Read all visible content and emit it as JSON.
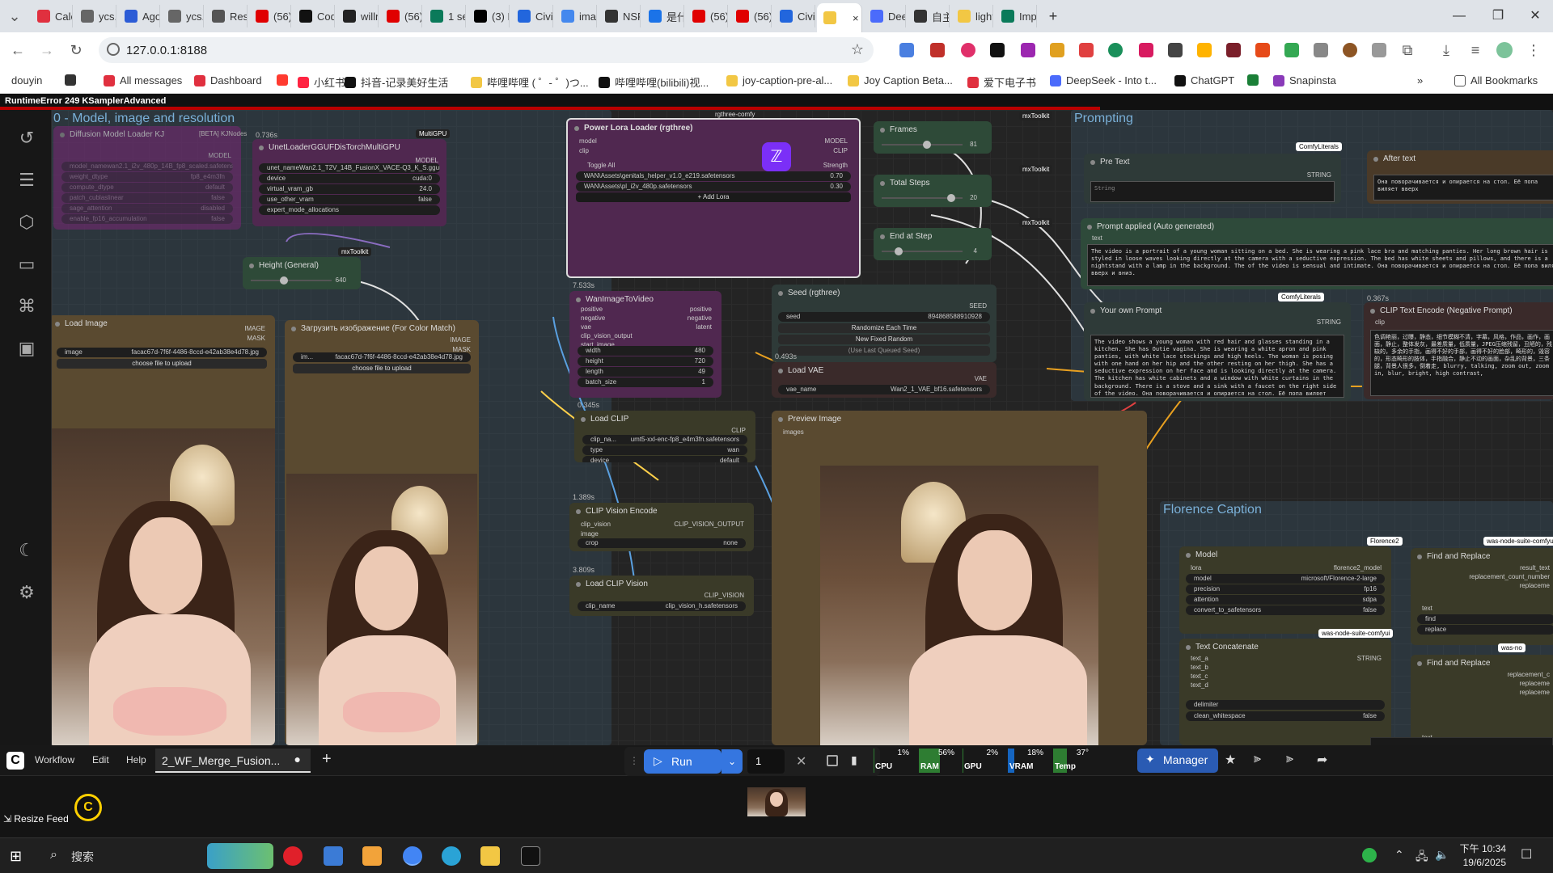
{
  "browser": {
    "tabs": [
      {
        "label": "Cale",
        "color": "#e0303f"
      },
      {
        "label": "ycs.a",
        "color": "#666666"
      },
      {
        "label": "Ago",
        "color": "#2c5cd6"
      },
      {
        "label": "ycs.a",
        "color": "#666666"
      },
      {
        "label": "Rese",
        "color": "#555555"
      },
      {
        "label": "(56)",
        "color": "#e00000"
      },
      {
        "label": "Cod",
        "color": "#111111"
      },
      {
        "label": "willn",
        "color": "#222222"
      },
      {
        "label": "(56)",
        "color": "#e00000"
      },
      {
        "label": "1 se",
        "color": "#0a7a5a"
      },
      {
        "label": "(3) F",
        "color": "#000000"
      },
      {
        "label": "Civit",
        "color": "#2266dd"
      },
      {
        "label": "imag",
        "color": "#4488ee"
      },
      {
        "label": "NSF",
        "color": "#333333"
      },
      {
        "label": "是什",
        "color": "#1b73e8"
      },
      {
        "label": "(56)",
        "color": "#e00000"
      },
      {
        "label": "(56)",
        "color": "#e00000"
      },
      {
        "label": "Civit",
        "color": "#2266dd"
      },
      {
        "label": "",
        "color": "#f2c744",
        "active": true
      },
      {
        "label": "Dee",
        "color": "#4b6bfb"
      },
      {
        "label": "自主",
        "color": "#333333"
      },
      {
        "label": "light",
        "color": "#f2c744"
      },
      {
        "label": "Imp",
        "color": "#0a7a5a"
      }
    ],
    "close_tab": "×",
    "new_tab": "+",
    "window_min": "—",
    "window_max": "❐",
    "window_close": "✕",
    "url": "127.0.0.1:8188",
    "bookmarks": [
      {
        "label": "douyin",
        "color": "#ffffff"
      },
      {
        "label": "",
        "color": "#333333"
      },
      {
        "label": "All messages",
        "color": "#e0303f"
      },
      {
        "label": "Dashboard",
        "color": "#e0303f"
      },
      {
        "label": "",
        "color": "#ff3b30"
      },
      {
        "label": "小红书",
        "color": "#ff2442"
      },
      {
        "label": "抖音-记录美好生活",
        "color": "#111111"
      },
      {
        "label": "哔哩哔哩 ( ゜- ゜)つ...",
        "color": "#f2c744"
      },
      {
        "label": "哔哩哔哩(bilibili)视...",
        "color": "#111111"
      },
      {
        "label": "joy-caption-pre-al...",
        "color": "#f2c744"
      },
      {
        "label": "Joy Caption Beta...",
        "color": "#f2c744"
      },
      {
        "label": "爱下电子书",
        "color": "#e0303f"
      },
      {
        "label": "DeepSeek - Into t...",
        "color": "#4b6bfb"
      },
      {
        "label": "ChatGPT",
        "color": "#111111"
      },
      {
        "label": "",
        "color": "#1a7f37"
      },
      {
        "label": "Snapinsta",
        "color": "#8a3ab9"
      }
    ],
    "bookmarks_more": "»",
    "all_bookmarks": "All Bookmarks"
  },
  "app": {
    "error_text": "RuntimeError 249 KSamplerAdvanced",
    "groups": {
      "model": "0 - Model, image and resolution",
      "prompting": "Prompting",
      "florence": "Florence Caption"
    },
    "nodes": {
      "diffusion": {
        "title": "Diffusion Model Loader KJ",
        "badge": "[BETA] KJNodes",
        "out": "MODEL",
        "widgets": [
          [
            "model_name",
            "wan2.1_i2v_480p_14B_fp8_scaled.safetensors"
          ],
          [
            "weight_dtype",
            "fp8_e4m3fn"
          ],
          [
            "compute_dtype",
            "default"
          ],
          [
            "patch_cublaslinear",
            "false"
          ],
          [
            "sage_attention",
            "disabled"
          ],
          [
            "enable_fp16_accumulation",
            "false"
          ]
        ]
      },
      "unet": {
        "time": "0.736s",
        "badge": "MultiGPU",
        "title": "UnetLoaderGGUFDisTorchMultiGPU",
        "out": "MODEL",
        "widgets": [
          [
            "unet_name",
            "Wan2.1_T2V_14B_FusionX_VACE-Q3_K_S.gguf"
          ],
          [
            "device",
            "cuda:0"
          ],
          [
            "virtual_vram_gb",
            "24.0"
          ],
          [
            "use_other_vram",
            "false"
          ],
          [
            "expert_mode_allocations",
            ""
          ]
        ]
      },
      "lora": {
        "badge": "rgthree-comfy",
        "title": "Power Lora Loader (rgthree)",
        "in_model": "model",
        "in_clip": "clip",
        "out_model": "MODEL",
        "out_clip": "CLIP",
        "toggle_all": "Toggle All",
        "strength": "Strength",
        "loras": [
          [
            "WAN\\Assets\\genitals_helper_v1.0_e219.safetensors",
            "0.70"
          ],
          [
            "WAN\\Assets\\pl_i2v_480p.safetensors",
            "0.30"
          ]
        ],
        "add": "+ Add Lora"
      },
      "frames": {
        "title": "Frames",
        "badge": "mxToolkit",
        "value": "81",
        "fraction": 0.55
      },
      "total_steps": {
        "title": "Total Steps",
        "badge": "mxToolkit",
        "value": "20",
        "fraction": 0.85
      },
      "end_step": {
        "title": "End at Step",
        "badge": "mxToolkit",
        "value": "4",
        "fraction": 0.2
      },
      "height": {
        "title": "Height (General)",
        "badge": "mxToolkit",
        "value": "640",
        "fraction": 0.4
      },
      "load_image": {
        "title": "Load Image",
        "out_image": "IMAGE",
        "out_mask": "MASK",
        "image": "facac67d-7f6f-4486-8ccd-e42ab38e4d78.jpg",
        "upload": "choose file to upload"
      },
      "load_image2": {
        "title": "Загрузить изображение (For Color Match)",
        "out_image": "IMAGE",
        "out_mask": "MASK",
        "image": "facac67d-7f6f-4486-8ccd-e42ab38e4d78.jpg",
        "upload": "choose file to upload"
      },
      "wan": {
        "time": "7.533s",
        "title": "WanImageToVideo",
        "inputs": [
          "positive",
          "negative",
          "vae",
          "clip_vision_output",
          "start_image"
        ],
        "outputs": [
          "positive",
          "negative",
          "latent"
        ],
        "widgets": [
          [
            "width",
            "480"
          ],
          [
            "height",
            "720"
          ],
          [
            "length",
            "49"
          ],
          [
            "batch_size",
            "1"
          ]
        ]
      },
      "seed": {
        "badge": "rgthree-comfy",
        "title": "Seed (rgthree)",
        "out": "SEED",
        "seed_label": "seed",
        "seed_value": "894868588910928",
        "btn1": "Randomize Each Time",
        "btn2": "New Fixed Random",
        "btn3": "(Use Last Queued Seed)"
      },
      "vae": {
        "time": "0.493s",
        "title": "Load VAE",
        "out": "VAE",
        "label": "vae_name",
        "value": "Wan2_1_VAE_bf16.safetensors"
      },
      "clip": {
        "time": "0.345s",
        "title": "Load CLIP",
        "out": "CLIP",
        "widgets": [
          [
            "clip_na...",
            "umt5-xxl-enc-fp8_e4m3fn.safetensors"
          ],
          [
            "type",
            "wan"
          ],
          [
            "device",
            "default"
          ]
        ]
      },
      "clip_vision_encode": {
        "time": "1.389s",
        "title": "CLIP Vision Encode",
        "in1": "clip_vision",
        "in2": "image",
        "out": "CLIP_VISION_OUTPUT",
        "crop_label": "crop",
        "crop_value": "none"
      },
      "clip_vision": {
        "time": "3.809s",
        "title": "Load CLIP Vision",
        "out": "CLIP_VISION",
        "label": "clip_name",
        "value": "clip_vision_h.safetensors"
      },
      "preview": {
        "title": "Preview Image",
        "in": "images"
      },
      "pre_text": {
        "title": "Pre Text",
        "badge": "ComfyLiterals",
        "out": "STRING",
        "placeholder": "String"
      },
      "after_text": {
        "title": "After text",
        "text": "Она поворачивается и опирается на стол. Её попа виляет вверх"
      },
      "prompt_applied": {
        "title": "Prompt applied (Auto generated)",
        "in": "text",
        "text": "The video is a portrait of a young woman sitting on a bed. She is wearing a pink lace bra and matching panties. Her long brown hair is styled in loose waves looking directly at the camera with a seductive expression. The bed has white sheets and pillows, and there is a nightstand with a lamp in the background. The of the video is sensual and intimate. Она поворачивается и опирается на стол. Её попа виляет вверх и вниз."
      },
      "own_prompt": {
        "badge": "ComfyLiterals",
        "title": "Your own Prompt",
        "out": "STRING",
        "text": "The video shows a young woman with red hair and glasses standing in a kitchen. She has Outie vagina. She is wearing a white apron and pink panties, with white lace stockings and high heels. The woman is posing with one hand on her hip and the other resting on her thigh. She has a seductive expression on her face and is looking directly at the camera. The kitchen has white cabinets and a window with white curtains in the background. There is a stove and a sink with a faucet on the right side of the video. Она поворачивается и опирается на стол. Её попа виляет вверх и вниз."
      },
      "neg": {
        "time": "0.367s",
        "title": "CLIP Text Encode (Negative Prompt)",
        "in": "clip",
        "text": "色调艳丽，过曝，静态，细节模糊不清，字幕，风格，作品，画作，画面，静止，整体发灰，最差质量，低质量，JPEG压缩残留，丑陋的，残缺的，多余的手指，画得不好的手部，画得不好的脸部，畸形的，毁容的，形态畸形的肢体，手指融合，静止不动的画面，杂乱的背景，三条腿，背景人很多，倒着走, blurry, talking, zoom out, zoom in, blur, bright, high contrast,"
      },
      "model": {
        "badge": "Florence2",
        "title": "Model",
        "in": "lora",
        "out": "florence2_model",
        "widgets": [
          [
            "model",
            "microsoft/Florence-2-large"
          ],
          [
            "precision",
            "fp16"
          ],
          [
            "attention",
            "sdpa"
          ],
          [
            "convert_to_safetensors",
            "false"
          ]
        ]
      },
      "text_concat": {
        "badge": "was-node-suite-comfyui",
        "title": "Text Concatenate",
        "out": "STRING",
        "inputs": [
          "text_a",
          "text_b",
          "text_c",
          "text_d"
        ],
        "widgets": [
          [
            "delimiter",
            ""
          ],
          [
            "clean_whitespace",
            "false"
          ]
        ]
      },
      "find1": {
        "badge": "was-node-suite-comfyui",
        "title": "Find and Replace",
        "outs": [
          "result_text",
          "replacement_count_number",
          "replaceme"
        ],
        "in": "text",
        "widgets": [
          [
            "find",
            ""
          ],
          [
            "replace",
            ""
          ]
        ]
      },
      "find2": {
        "badge": "was-no",
        "title": "Find and Replace",
        "outs": [
          "replacement_c",
          "replaceme",
          "replaceme"
        ],
        "in": "text"
      }
    },
    "bottom": {
      "menu": [
        "Workflow",
        "Edit",
        "Help"
      ],
      "workflow_tab": "2_WF_Merge_Fusion...",
      "add_tab": "+",
      "run": "Run",
      "queue_count": "1",
      "stats": [
        {
          "label": "CPU",
          "value": "1%",
          "fill": 0.01,
          "color": "#2e7d32"
        },
        {
          "label": "RAM",
          "value": "56%",
          "fill": 0.56,
          "color": "#2e7d32"
        },
        {
          "label": "GPU",
          "value": "2%",
          "fill": 0.02,
          "color": "#2e7d32"
        },
        {
          "label": "VRAM",
          "value": "18%",
          "fill": 0.18,
          "color": "#1565c0"
        },
        {
          "label": "Temp",
          "value": "37°",
          "fill": 0.37,
          "color": "#2e7d32"
        }
      ],
      "manager": "Manager",
      "resize_feed": "Resize Feed"
    }
  },
  "taskbar": {
    "search": "搜索",
    "time": "下午 10:34",
    "date": "19/6/2025"
  }
}
